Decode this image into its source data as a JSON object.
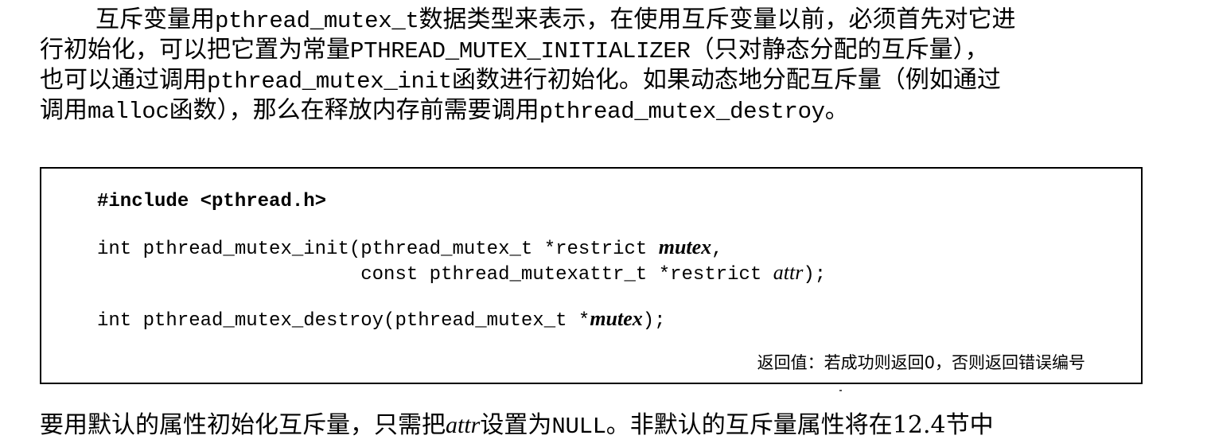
{
  "intro": {
    "line1": {
      "a": "互斥变量用",
      "b": "pthread_mutex_t",
      "c": "数据类型来表示，在使用互斥变量以前，必须首先对它进"
    },
    "line2": {
      "a": "行初始化，可以把它置为常量",
      "b": "PTHREAD_MUTEX_INITIALIZER",
      "c": "（只对静态分配的互斥量），"
    },
    "line3": {
      "a": "也可以通过调用",
      "b": "pthread_mutex_init",
      "c": "函数进行初始化。如果动态地分配互斥量（例如通过"
    },
    "line4": {
      "a": "调用",
      "b": "malloc",
      "c": "函数），那么在释放内存前需要调用",
      "d": "pthread_mutex_destroy",
      "e": "。"
    }
  },
  "code": {
    "include": "#include <pthread.h>",
    "init_line1_a": "int pthread_mutex_init(pthread_mutex_t *restrict ",
    "init_line1_param": "mutex",
    "init_line1_b": ",",
    "init_line2_a": "                       const pthread_mutexattr_t *restrict ",
    "init_line2_param": "attr",
    "init_line2_b": ");",
    "destroy_a": "int pthread_mutex_destroy(pthread_mutex_t *",
    "destroy_param": "mutex",
    "destroy_b": ");",
    "return_value": "返回值：若成功则返回0，否则返回错误编号"
  },
  "outro": {
    "a": "要用默认的属性初始化互斥量，只需把",
    "b": "attr",
    "c": "设置为",
    "d": "NULL",
    "e": "。非默认的互斥量属性将在12.4节中"
  }
}
